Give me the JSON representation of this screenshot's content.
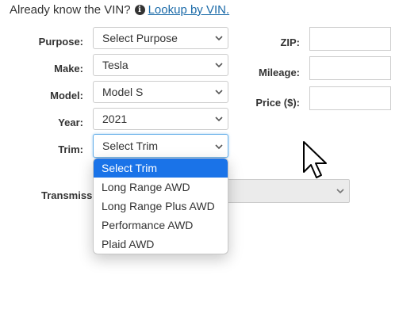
{
  "vin_prompt": {
    "text": "Already know the VIN?",
    "link": "Lookup by VIN."
  },
  "form": {
    "purpose": {
      "label": "Purpose:",
      "value": "Select Purpose"
    },
    "make": {
      "label": "Make:",
      "value": "Tesla"
    },
    "model": {
      "label": "Model:",
      "value": "Model S"
    },
    "year": {
      "label": "Year:",
      "value": "2021"
    },
    "trim": {
      "label": "Trim:",
      "value": "Select Trim"
    },
    "transmission": {
      "label": "Transmissi",
      "value": ""
    },
    "zip": {
      "label": "ZIP:",
      "value": ""
    },
    "mileage": {
      "label": "Mileage:",
      "value": ""
    },
    "price": {
      "label": "Price ($):",
      "value": ""
    }
  },
  "trim_dropdown": {
    "options": [
      "Select Trim",
      "Long Range AWD",
      "Long Range Plus AWD",
      "Performance AWD",
      "Plaid AWD"
    ],
    "selected_index": 0
  },
  "colors": {
    "link": "#1a6aa8",
    "selected_option": "#1a73e8",
    "focus_border": "#66afe9"
  },
  "icons": {
    "info": "info-icon",
    "chevron": "chevron-down-icon",
    "cursor": "mouse-pointer-icon"
  }
}
